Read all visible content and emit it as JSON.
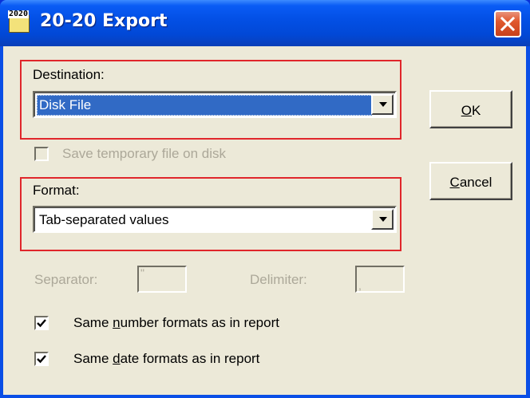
{
  "window": {
    "title": "20-20 Export",
    "icon_label": "2020",
    "close_icon": "close-icon"
  },
  "destination": {
    "label": "Destination:",
    "value": "Disk File"
  },
  "save_temp": {
    "label": "Save temporary file on disk",
    "checked": false,
    "enabled": false
  },
  "format": {
    "label": "Format:",
    "value": "Tab-separated values"
  },
  "separator": {
    "label": "Separator:",
    "value": "\""
  },
  "delimiter": {
    "label": "Delimiter:",
    "value": ","
  },
  "same_number": {
    "before": "Same ",
    "accel": "n",
    "after": "umber formats as in report",
    "checked": true
  },
  "same_date": {
    "before": "Same ",
    "accel": "d",
    "after": "ate formats as in report",
    "checked": true
  },
  "buttons": {
    "ok_accel": "O",
    "ok_rest": "K",
    "cancel_accel": "C",
    "cancel_rest": "ancel"
  },
  "colors": {
    "highlight": "#e0262b",
    "selection": "#316ac5",
    "face": "#ece9d8"
  }
}
